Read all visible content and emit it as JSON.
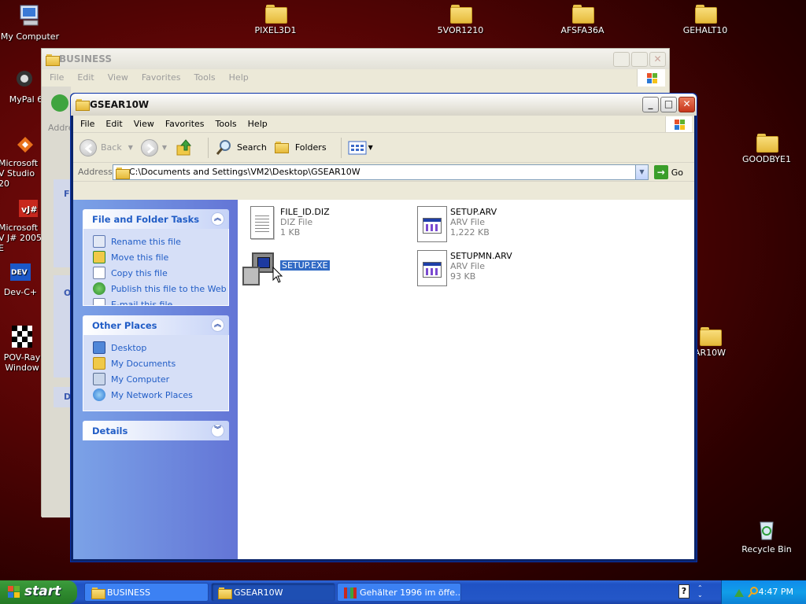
{
  "desktop": {
    "icons": {
      "my_computer": "My Computer",
      "pixel3d1": "PIXEL3D1",
      "vor1210": "5VOR1210",
      "afsfa36a": "AFSFA36A",
      "gehalt10": "GEHALT10",
      "mypal": "MyPal 6",
      "ms_vs": "Microsoft V Studio 20",
      "ms_j": "Microsoft V J# 2005 E",
      "devc": "Dev-C+",
      "povray": "POV-Ray Window",
      "goodbye1": "GOODBYE1",
      "ar10w": "AR10W",
      "recycle": "Recycle Bin"
    }
  },
  "bg_window": {
    "title": "BUSINESS",
    "menu": [
      "File",
      "Edit",
      "View",
      "Favorites",
      "Tools",
      "Help"
    ],
    "address_label": "Addre",
    "side_labels": [
      "Fi",
      "O",
      "D"
    ]
  },
  "window": {
    "title": "GSEAR10W",
    "menu": {
      "file": "File",
      "edit": "Edit",
      "view": "View",
      "favorites": "Favorites",
      "tools": "Tools",
      "help": "Help"
    },
    "toolbar": {
      "back": "Back",
      "search": "Search",
      "folders": "Folders"
    },
    "address": {
      "label": "Address",
      "value": "C:\\Documents and Settings\\VM2\\Desktop\\GSEAR10W",
      "go": "Go"
    },
    "left_pane": {
      "file_tasks": {
        "title": "File and Folder Tasks",
        "items": [
          "Rename this file",
          "Move this file",
          "Copy this file",
          "Publish this file to the Web",
          "E-mail this file"
        ]
      },
      "other_places": {
        "title": "Other Places",
        "items": [
          "Desktop",
          "My Documents",
          "My Computer",
          "My Network Places"
        ]
      },
      "details": {
        "title": "Details"
      }
    },
    "files": [
      {
        "name": "FILE_ID.DIZ",
        "type": "DIZ File",
        "size": "1 KB"
      },
      {
        "name": "SETUP.ARV",
        "type": "ARV File",
        "size": "1,222 KB"
      },
      {
        "name": "SETUP.EXE",
        "type": "",
        "size": ""
      },
      {
        "name": "SETUPMN.ARV",
        "type": "ARV File",
        "size": "93 KB"
      }
    ]
  },
  "taskbar": {
    "start": "start",
    "buttons": [
      "BUSINESS",
      "GSEAR10W",
      "Gehälter 1996 im öffe..."
    ],
    "clock": "4:47 PM"
  }
}
